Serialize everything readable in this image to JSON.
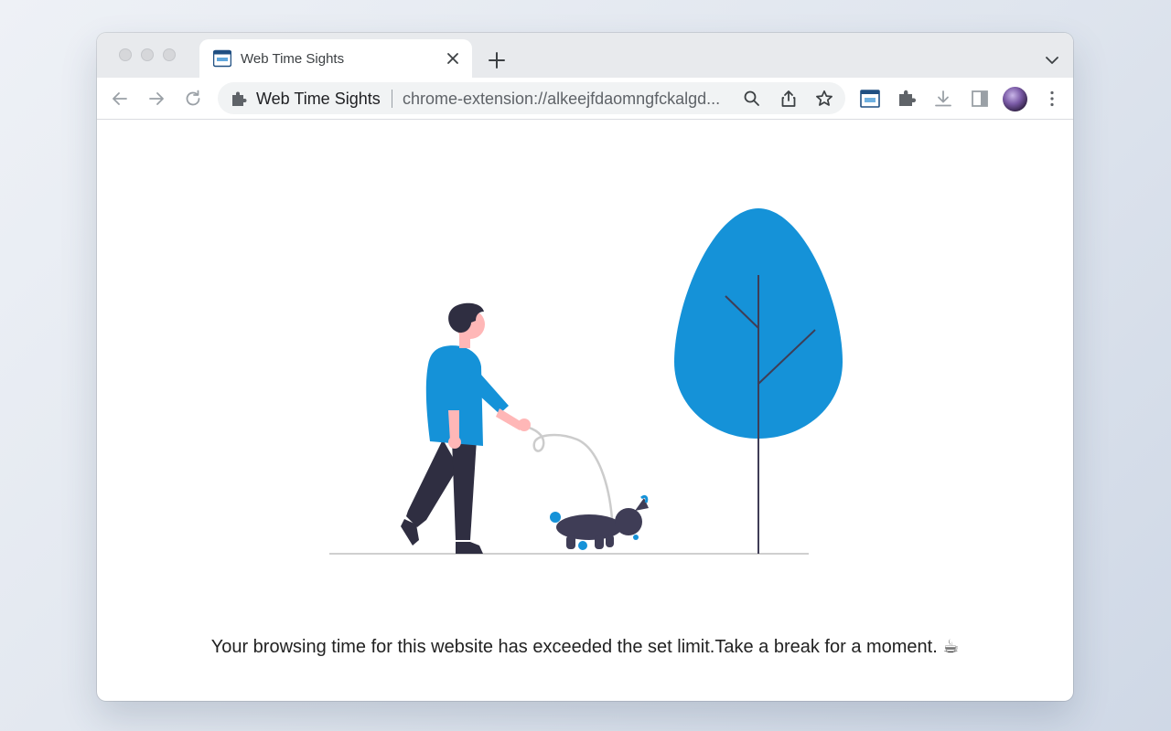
{
  "browser": {
    "tab": {
      "title": "Web Time Sights"
    },
    "omnibox": {
      "site_name": "Web Time Sights",
      "url": "chrome-extension://alkeejfdaomngfckalgd..."
    }
  },
  "page": {
    "message": "Your browsing time for this website has exceeded the set limit.Take a break for a moment. ☕"
  },
  "icons": {
    "favicon": "calendar-favicon-icon",
    "extension_in_toolbar": "web-time-sights-extension-icon"
  },
  "colors": {
    "accent_blue": "#1592d8",
    "dark_figure": "#2f2e41",
    "skin": "#ffb7b7"
  }
}
